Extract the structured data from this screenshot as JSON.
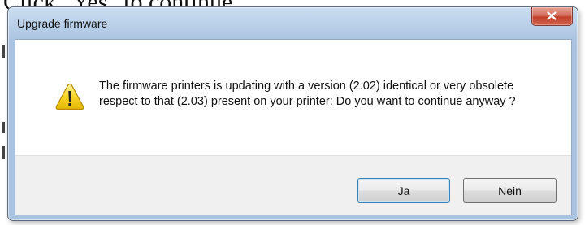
{
  "document": {
    "heading_text": "Click \"Yes\" to continue."
  },
  "dialog": {
    "title": "Upgrade firmware",
    "message": "The firmware printers is updating with a version (2.02) identical or very obsolete respect to that (2.03) present on your printer: Do you want to continue anyway ?",
    "icon": "warning-icon",
    "buttons": {
      "yes_label": "Ja",
      "no_label": "Nein"
    },
    "close_icon": "close-icon"
  },
  "colors": {
    "titlebar": "#aac3e0",
    "close_button": "#c9452f",
    "default_button_border": "#3c7fb1",
    "warning_yellow": "#f5d21c"
  }
}
